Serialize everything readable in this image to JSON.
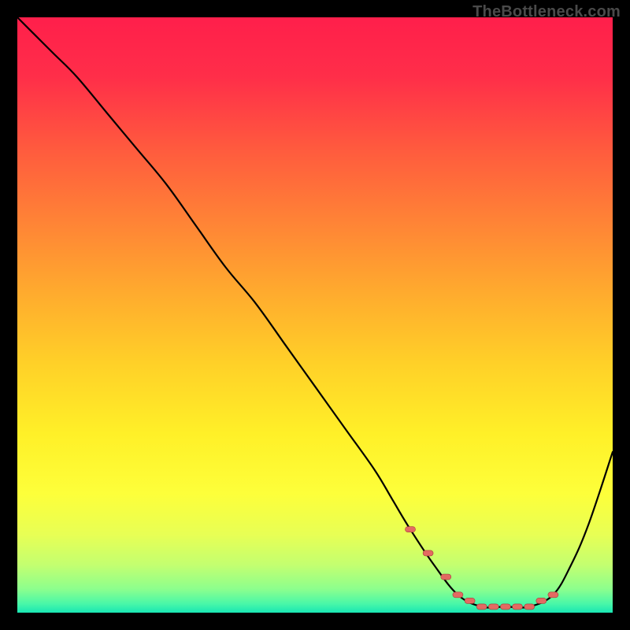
{
  "watermark": "TheBottleneck.com",
  "colors": {
    "frame_bg": "#000000",
    "watermark_text": "#4a4a4a",
    "gradient_stops": [
      {
        "offset": 0.0,
        "color": "#ff1f4b"
      },
      {
        "offset": 0.1,
        "color": "#ff2e49"
      },
      {
        "offset": 0.22,
        "color": "#ff5a3e"
      },
      {
        "offset": 0.34,
        "color": "#ff8236"
      },
      {
        "offset": 0.46,
        "color": "#ffaa2e"
      },
      {
        "offset": 0.58,
        "color": "#ffd028"
      },
      {
        "offset": 0.7,
        "color": "#fff028"
      },
      {
        "offset": 0.8,
        "color": "#fdff3a"
      },
      {
        "offset": 0.87,
        "color": "#e7ff55"
      },
      {
        "offset": 0.92,
        "color": "#c3ff70"
      },
      {
        "offset": 0.96,
        "color": "#8dff8d"
      },
      {
        "offset": 0.985,
        "color": "#49f7a8"
      },
      {
        "offset": 1.0,
        "color": "#19e6b3"
      }
    ],
    "curve": "#000000",
    "marker_fill": "#e36a62",
    "marker_stroke": "#a83d39"
  },
  "chart_data": {
    "type": "line",
    "title": "",
    "xlabel": "",
    "ylabel": "",
    "xlim": [
      0,
      100
    ],
    "ylim": [
      0,
      100
    ],
    "series": [
      {
        "name": "bottleneck-curve",
        "x": [
          0,
          3,
          6,
          10,
          15,
          20,
          25,
          30,
          35,
          40,
          45,
          50,
          55,
          60,
          63,
          66,
          70,
          74,
          78,
          82,
          86,
          90,
          93,
          96,
          100
        ],
        "y": [
          100,
          97,
          94,
          90,
          84,
          78,
          72,
          65,
          58,
          52,
          45,
          38,
          31,
          24,
          19,
          14,
          8,
          3,
          1,
          1,
          1,
          3,
          8,
          15,
          27
        ]
      }
    ],
    "markers": {
      "name": "optimal-range",
      "x": [
        66,
        69,
        72,
        74,
        76,
        78,
        80,
        82,
        84,
        86,
        88,
        90
      ],
      "y": [
        14,
        10,
        6,
        3,
        2,
        1,
        1,
        1,
        1,
        1,
        2,
        3
      ]
    }
  }
}
